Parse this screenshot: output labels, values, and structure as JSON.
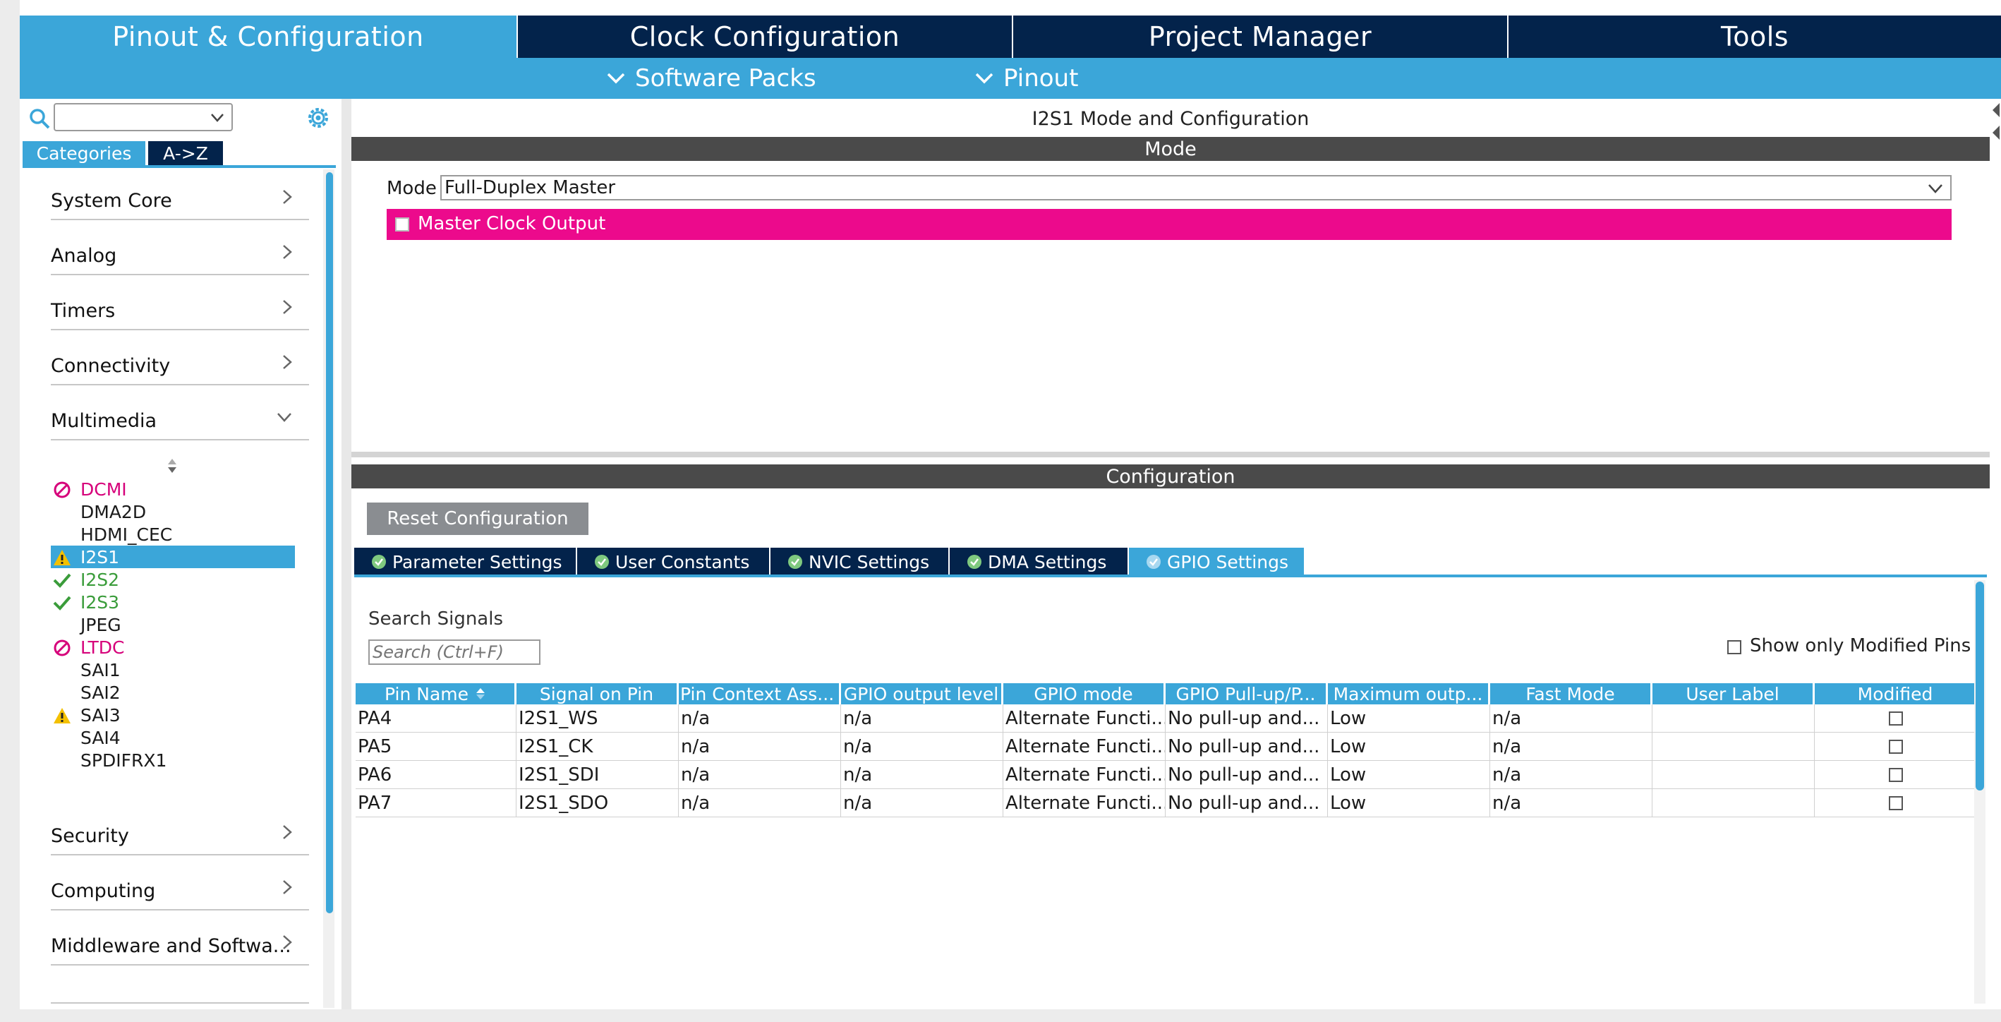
{
  "top_tabs": [
    "Pinout & Configuration",
    "Clock Configuration",
    "Project Manager",
    "Tools"
  ],
  "sub_menu": [
    "Software Packs",
    "Pinout"
  ],
  "sidebar": {
    "view_tabs": [
      "Categories",
      "A->Z"
    ],
    "categories_top": [
      "System Core",
      "Analog",
      "Timers",
      "Connectivity",
      "Multimedia"
    ],
    "multimedia_items": [
      {
        "label": "DCMI",
        "status": "disabled"
      },
      {
        "label": "DMA2D",
        "status": "none"
      },
      {
        "label": "HDMI_CEC",
        "status": "none"
      },
      {
        "label": "I2S1",
        "status": "warning"
      },
      {
        "label": "I2S2",
        "status": "ok"
      },
      {
        "label": "I2S3",
        "status": "ok"
      },
      {
        "label": "JPEG",
        "status": "none"
      },
      {
        "label": "LTDC",
        "status": "disabled"
      },
      {
        "label": "SAI1",
        "status": "none"
      },
      {
        "label": "SAI2",
        "status": "none"
      },
      {
        "label": "SAI3",
        "status": "warning"
      },
      {
        "label": "SAI4",
        "status": "none"
      },
      {
        "label": "SPDIFRX1",
        "status": "none"
      }
    ],
    "categories_bottom": [
      "Security",
      "Computing",
      "Middleware and Softwa..."
    ]
  },
  "main": {
    "title": "I2S1 Mode and Configuration",
    "mode_header": "Mode",
    "mode_label": "Mode",
    "mode_value": "Full-Duplex Master",
    "master_clock_label": "Master Clock Output",
    "config_header": "Configuration",
    "reset_button": "Reset Configuration",
    "config_tabs": [
      "Parameter Settings",
      "User Constants",
      "NVIC Settings",
      "DMA Settings",
      "GPIO Settings"
    ],
    "search_label": "Search Signals",
    "search_placeholder": "Search (Ctrl+F)",
    "show_modified_label": "Show only Modified Pins"
  },
  "table": {
    "headers": [
      "Pin Name",
      "Signal on Pin",
      "Pin Context Ass...",
      "GPIO output level",
      "GPIO mode",
      "GPIO Pull-up/P...",
      "Maximum outp...",
      "Fast Mode",
      "User Label",
      "Modified"
    ],
    "rows": [
      [
        "PA4",
        "I2S1_WS",
        "n/a",
        "n/a",
        "Alternate Functi...",
        "No pull-up and...",
        "Low",
        "n/a",
        "",
        ""
      ],
      [
        "PA5",
        "I2S1_CK",
        "n/a",
        "n/a",
        "Alternate Functi...",
        "No pull-up and...",
        "Low",
        "n/a",
        "",
        ""
      ],
      [
        "PA6",
        "I2S1_SDI",
        "n/a",
        "n/a",
        "Alternate Functi...",
        "No pull-up and...",
        "Low",
        "n/a",
        "",
        ""
      ],
      [
        "PA7",
        "I2S1_SDO",
        "n/a",
        "n/a",
        "Alternate Functi...",
        "No pull-up and...",
        "Low",
        "n/a",
        "",
        ""
      ]
    ]
  },
  "colors": {
    "accent": "#3ba6d9",
    "navy": "#03234b",
    "magenta": "#ec0a8c",
    "header_gray": "#4a4a4a",
    "ok_green": "#3a9c3a",
    "warn_yellow": "#f3c000"
  }
}
